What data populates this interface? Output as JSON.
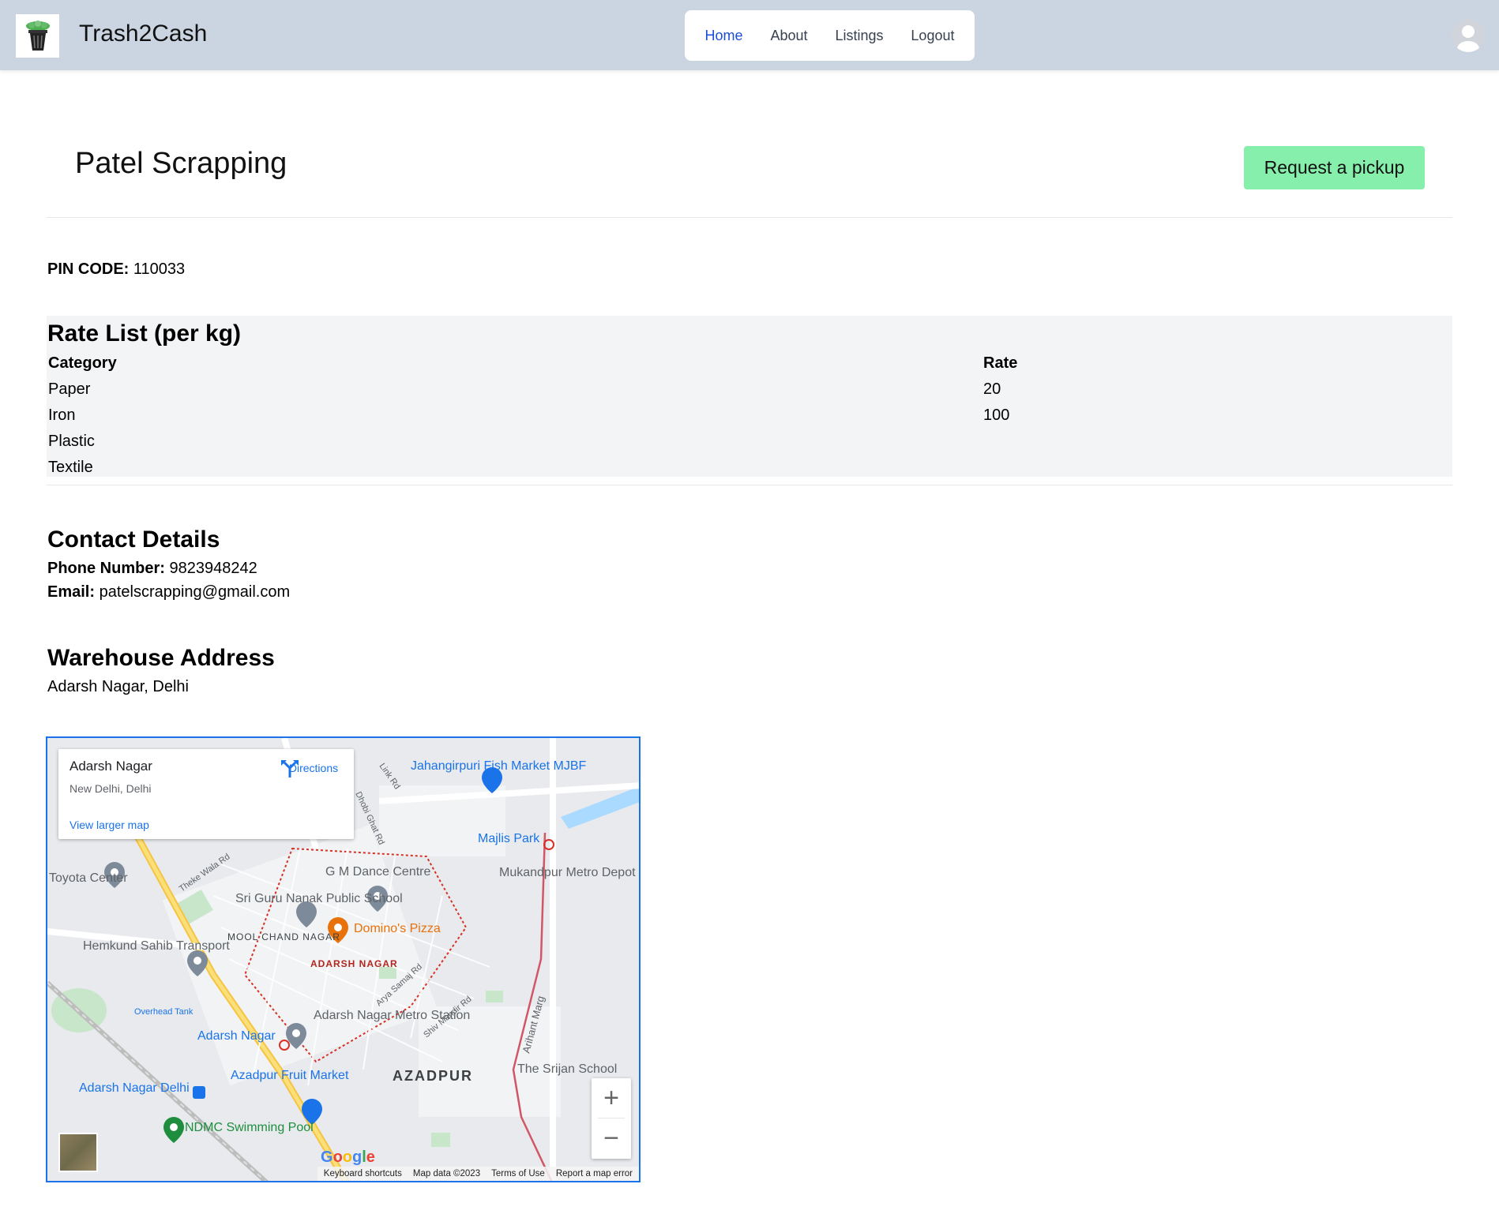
{
  "header": {
    "brand": "Trash2Cash",
    "logo_icon": "trash-bin-icon",
    "nav": [
      {
        "label": "Home",
        "active": true
      },
      {
        "label": "About",
        "active": false
      },
      {
        "label": "Listings",
        "active": false
      },
      {
        "label": "Logout",
        "active": false
      }
    ],
    "avatar_icon": "user-avatar-icon"
  },
  "listing": {
    "name": "Patel Scrapping",
    "pickup_button": "Request a pickup",
    "pin_label": "PIN CODE:",
    "pin_value": "110033"
  },
  "rate_list": {
    "title": "Rate List (per kg)",
    "columns": [
      "Category",
      "Rate"
    ],
    "rows": [
      {
        "category": "Paper",
        "rate": "20"
      },
      {
        "category": "Iron",
        "rate": "100"
      },
      {
        "category": "Plastic",
        "rate": ""
      },
      {
        "category": "Textile",
        "rate": ""
      }
    ]
  },
  "contact": {
    "title": "Contact Details",
    "phone_label": "Phone Number:",
    "phone_value": "9823948242",
    "email_label": "Email:",
    "email_value": "patelscrapping@gmail.com"
  },
  "address": {
    "title": "Warehouse Address",
    "value": "Adarsh Nagar, Delhi"
  },
  "map": {
    "place_title": "Adarsh Nagar",
    "place_sub": "New Delhi, Delhi",
    "directions": "Directions",
    "larger_map": "View larger map",
    "zoom_in": "+",
    "zoom_out": "−",
    "attribution": [
      "Keyboard shortcuts",
      "Map data ©2023",
      "Terms of Use",
      "Report a map error"
    ],
    "labels": [
      "Jahangirpuri Fish Market MJBF",
      "Majlis Park",
      "Mukandpur Metro Depot",
      "G M Dance Centre",
      "Sri Guru Nanak Public School",
      "Domino's Pizza",
      "Toyota Center",
      "Hemkund Sahib Transport",
      "MOOL CHAND NAGAR",
      "ADARSH NAGAR",
      "Adarsh Nagar Metro Station",
      "Adarsh Nagar",
      "Azadpur Fruit Market",
      "AZADPUR",
      "Adarsh Nagar Delhi",
      "NDMC Swimming Pool",
      "The Srijan School",
      "Overhead Tank",
      "Link Rd",
      "Dhobi Ghat Rd",
      "Theke Wala Rd",
      "Arya Samaj Rd",
      "Shiv Mandir Rd",
      "Arihant Marg"
    ],
    "google": "Google"
  }
}
